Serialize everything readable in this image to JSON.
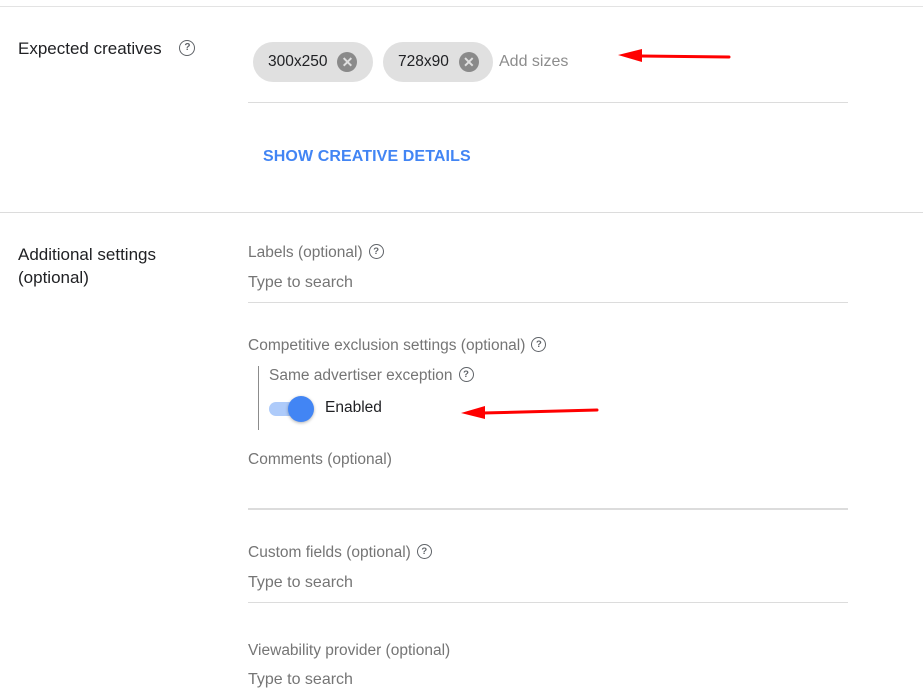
{
  "expected_creatives": {
    "title": "Expected creatives",
    "help_icon": "help-circle-icon",
    "chips": [
      {
        "label": "300x250",
        "remove_icon": "cancel-icon"
      },
      {
        "label": "728x90",
        "remove_icon": "cancel-icon"
      }
    ],
    "input_placeholder": "Add sizes",
    "show_details_label": "SHOW CREATIVE DETAILS"
  },
  "additional_settings": {
    "title": "Additional settings (optional)",
    "labels": {
      "label": "Labels (optional)",
      "placeholder": "Type to search"
    },
    "competitive_exclusion": {
      "label": "Competitive exclusion settings (optional)",
      "same_advertiser_exception": {
        "label": "Same advertiser exception",
        "toggle_on": true,
        "state_label": "Enabled"
      }
    },
    "comments": {
      "label": "Comments (optional)",
      "value": ""
    },
    "custom_fields": {
      "label": "Custom fields (optional)",
      "placeholder": "Type to search"
    },
    "viewability_provider": {
      "label": "Viewability provider (optional)",
      "placeholder": "Type to search"
    }
  },
  "annotations": {
    "arrow_color": "#ff0000",
    "accent_color": "#4285f4"
  }
}
